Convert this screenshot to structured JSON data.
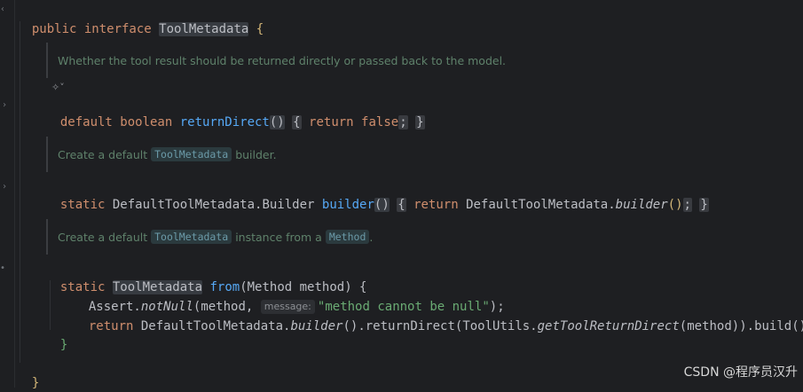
{
  "editor": {
    "line1": {
      "kw": "public interface ",
      "name": "ToolMetadata",
      "brace": " {"
    },
    "doc1": "Whether the tool result should be returned directly or passed back to the model.",
    "ai_hint_icon": "ai-assist-icon",
    "line2": {
      "kw": "default boolean ",
      "fn": "returnDirect",
      "parens": "()",
      "open": "{",
      "ret": " return ",
      "val": "false",
      "semi": ";",
      "close": "}"
    },
    "doc2": {
      "pre": "Create a default ",
      "chip": "ToolMetadata",
      "post": " builder."
    },
    "line3": {
      "kw": "static ",
      "type": "DefaultToolMetadata.Builder ",
      "fn": "builder",
      "parens": "()",
      "open": "{",
      "ret": " return ",
      "cls": "DefaultToolMetadata.",
      "call": "builder",
      "callparens": "()",
      "semi": ";",
      "close": "}"
    },
    "doc3": {
      "pre": "Create a default ",
      "chip1": "ToolMetadata",
      "mid": " instance from a ",
      "chip2": "Method",
      "post": "."
    },
    "line4": {
      "kw": "static ",
      "type": "ToolMetadata",
      "fn": " from",
      "params": "(Method method) {"
    },
    "line5": {
      "pre": "Assert.",
      "call": "notNull",
      "args": "(method, ",
      "hint": "message:",
      "str": "\"method cannot be null\"",
      "end": ");"
    },
    "line6": {
      "ret": "return ",
      "cls": "DefaultToolMetadata.",
      "call": "builder",
      "mid": "().returnDirect(ToolUtils.",
      "call2": "getToolReturnDirect",
      "end": "(method)).build();"
    },
    "line7": "}",
    "line8": "}"
  },
  "watermark": "CSDN @程序员汉升"
}
